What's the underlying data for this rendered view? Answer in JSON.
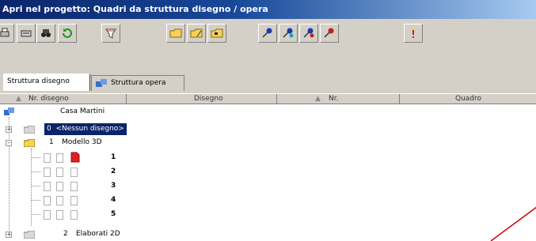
{
  "window": {
    "title": "Apri nel progetto: Quadri da struttura disegno / opera"
  },
  "toolbar": {
    "buttons": [
      "print-icon",
      "print-preview-icon",
      "binoculars-icon",
      "refresh-icon",
      "filter-icon",
      "new-folder-icon",
      "edit-folder-icon",
      "open-folder-icon",
      "pin-blue-icon",
      "pin-blue-teal-icon",
      "pin-blue-red-icon",
      "pin-red-icon",
      "info-icon"
    ]
  },
  "tabs": [
    {
      "label": "Struttura disegno"
    },
    {
      "label": "Struttura opera"
    }
  ],
  "columns": {
    "c1": "Nr. disegno",
    "c2": "Disegno",
    "c3": "Nr.",
    "c4": "Quadro"
  },
  "tree": {
    "root": "Casa Martini",
    "n0": {
      "num": "0",
      "name": "<Nessun disegno>"
    },
    "n1": {
      "num": "1",
      "name": "Modello 3D"
    },
    "children": [
      "1",
      "2",
      "3",
      "4",
      "5"
    ],
    "n2": {
      "num": "2",
      "name": "Elaborati 2D"
    }
  },
  "colors": {
    "title_start": "#0a246a",
    "title_end": "#a6caf0",
    "annotation": "#cc0000"
  }
}
